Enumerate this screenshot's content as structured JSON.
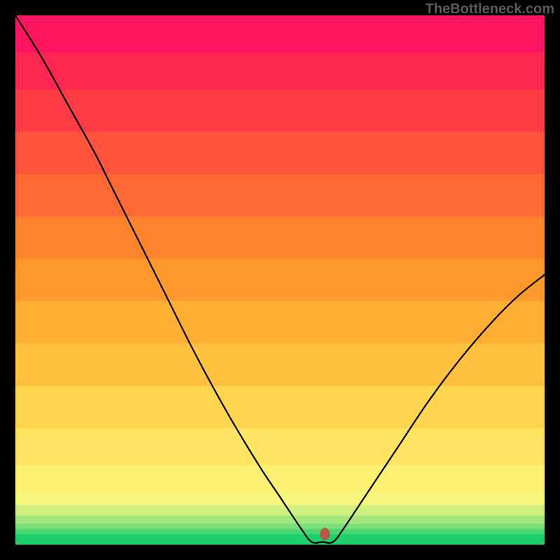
{
  "watermark": "TheBottleneck.com",
  "chart_data": {
    "type": "line",
    "title": "",
    "xlabel": "",
    "ylabel": "",
    "xlim": [
      0,
      1
    ],
    "ylim": [
      0,
      1
    ],
    "optimum_x": 0.58,
    "marker": {
      "x": 0.585,
      "y": 0.02,
      "color": "#b4594b"
    },
    "curve": [
      {
        "x": 0.0,
        "y": 1.0
      },
      {
        "x": 0.05,
        "y": 0.92
      },
      {
        "x": 0.1,
        "y": 0.83
      },
      {
        "x": 0.15,
        "y": 0.74
      },
      {
        "x": 0.18,
        "y": 0.68
      },
      {
        "x": 0.22,
        "y": 0.6
      },
      {
        "x": 0.28,
        "y": 0.48
      },
      {
        "x": 0.34,
        "y": 0.36
      },
      {
        "x": 0.4,
        "y": 0.25
      },
      {
        "x": 0.46,
        "y": 0.15
      },
      {
        "x": 0.5,
        "y": 0.09
      },
      {
        "x": 0.54,
        "y": 0.03
      },
      {
        "x": 0.56,
        "y": 0.005
      },
      {
        "x": 0.58,
        "y": 0.005
      },
      {
        "x": 0.6,
        "y": 0.005
      },
      {
        "x": 0.62,
        "y": 0.03
      },
      {
        "x": 0.66,
        "y": 0.09
      },
      {
        "x": 0.72,
        "y": 0.18
      },
      {
        "x": 0.78,
        "y": 0.27
      },
      {
        "x": 0.84,
        "y": 0.35
      },
      {
        "x": 0.9,
        "y": 0.42
      },
      {
        "x": 0.95,
        "y": 0.47
      },
      {
        "x": 1.0,
        "y": 0.51
      }
    ],
    "gradient_bands": [
      {
        "y0": 0.0,
        "y1": 0.02,
        "color": "#1fce6d"
      },
      {
        "y0": 0.02,
        "y1": 0.03,
        "color": "#4ed673"
      },
      {
        "y0": 0.03,
        "y1": 0.04,
        "color": "#7cdf79"
      },
      {
        "y0": 0.04,
        "y1": 0.055,
        "color": "#a6e77d"
      },
      {
        "y0": 0.055,
        "y1": 0.075,
        "color": "#d1ef7f"
      },
      {
        "y0": 0.075,
        "y1": 0.1,
        "color": "#f6f67d"
      },
      {
        "y0": 0.1,
        "y1": 0.15,
        "color": "#fdf174"
      },
      {
        "y0": 0.15,
        "y1": 0.22,
        "color": "#ffe362"
      },
      {
        "y0": 0.22,
        "y1": 0.3,
        "color": "#ffd44e"
      },
      {
        "y0": 0.3,
        "y1": 0.38,
        "color": "#ffc13d"
      },
      {
        "y0": 0.38,
        "y1": 0.46,
        "color": "#ffad33"
      },
      {
        "y0": 0.46,
        "y1": 0.54,
        "color": "#ff992d"
      },
      {
        "y0": 0.54,
        "y1": 0.62,
        "color": "#ff832d"
      },
      {
        "y0": 0.62,
        "y1": 0.7,
        "color": "#ff6b32"
      },
      {
        "y0": 0.7,
        "y1": 0.78,
        "color": "#ff543b"
      },
      {
        "y0": 0.78,
        "y1": 0.86,
        "color": "#ff3c46"
      },
      {
        "y0": 0.86,
        "y1": 0.93,
        "color": "#ff2752"
      },
      {
        "y0": 0.93,
        "y1": 1.0,
        "color": "#ff155f"
      }
    ]
  }
}
